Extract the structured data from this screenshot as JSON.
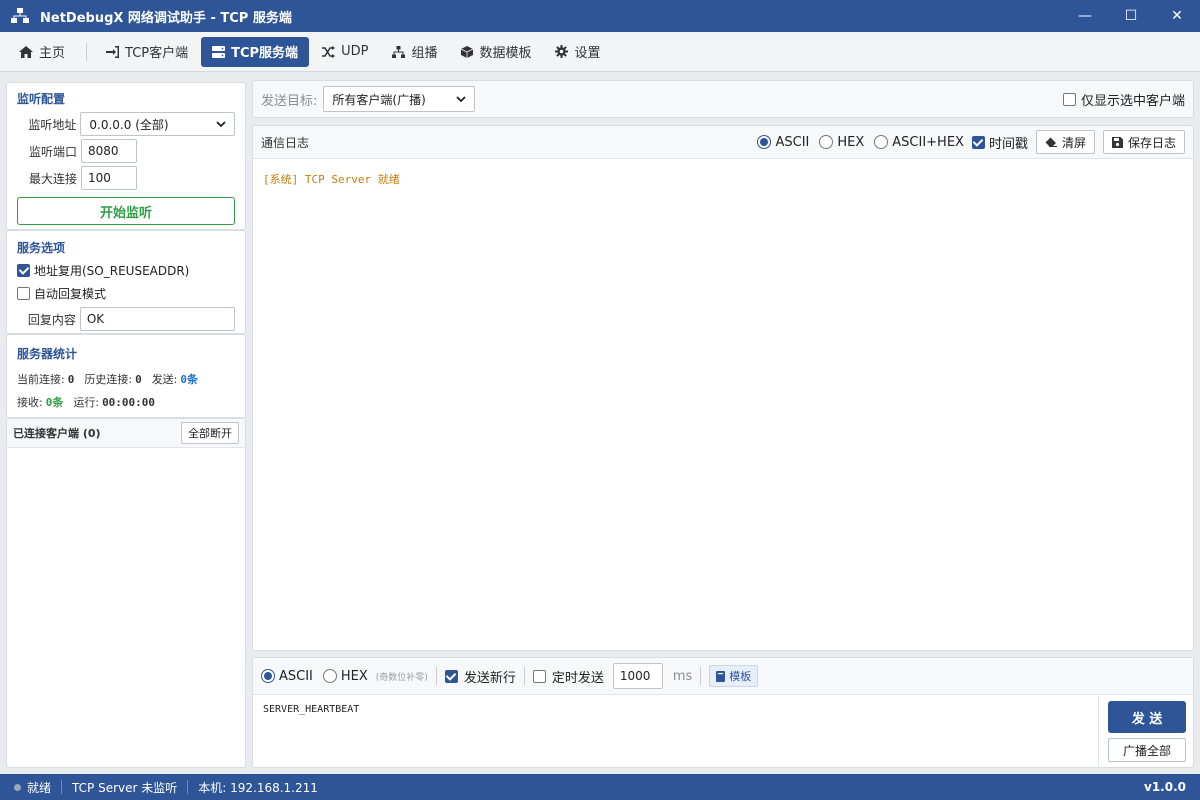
{
  "window": {
    "title": "NetDebugX 网络调试助手 - TCP 服务端",
    "minimize": "—",
    "maximize": "☐",
    "close": "✕"
  },
  "tabs": [
    {
      "label": "主页",
      "icon": "home-icon"
    },
    {
      "label": "TCP客户端",
      "icon": "sign-in-icon"
    },
    {
      "label": "TCP服务端",
      "icon": "server-icon",
      "active": true
    },
    {
      "label": "UDP",
      "icon": "shuffle-icon"
    },
    {
      "label": "组播",
      "icon": "sitemap-icon"
    },
    {
      "label": "数据模板",
      "icon": "cube-icon"
    },
    {
      "label": "设置",
      "icon": "gear-icon"
    }
  ],
  "listen": {
    "title": "监听配置",
    "addr_label": "监听地址",
    "addr_value": "0.0.0.0 (全部)",
    "port_label": "监听端口",
    "port_value": "8080",
    "max_label": "最大连接",
    "max_value": "100",
    "start_button": "开始监听"
  },
  "service": {
    "title": "服务选项",
    "reuse_label": "地址复用(SO_REUSEADDR)",
    "reuse_checked": true,
    "auto_reply_label": "自动回复模式",
    "auto_reply_checked": false,
    "reply_label": "回复内容",
    "reply_value": "OK"
  },
  "stats": {
    "title": "服务器统计",
    "current_label": "当前连接:",
    "current_value": "0",
    "history_label": "历史连接:",
    "history_value": "0",
    "sent_label": "发送:",
    "sent_value": "0条",
    "recv_label": "接收:",
    "recv_value": "0条",
    "uptime_label": "运行:",
    "uptime_value": "00:00:00"
  },
  "clients": {
    "title": "已连接客户端 (0)",
    "disconnect_all": "全部断开"
  },
  "send_target": {
    "label": "发送目标:",
    "value": "所有客户端(广播)",
    "only_selected_label": "仅显示选中客户端",
    "only_selected_checked": false
  },
  "log": {
    "title": "通信日志",
    "mode_ascii": "ASCII",
    "mode_hex": "HEX",
    "mode_both": "ASCII+HEX",
    "timestamp_label": "时间戳",
    "clear_button": "清屏",
    "save_button": "保存日志",
    "lines": [
      "[系统] TCP Server 就绪"
    ]
  },
  "send": {
    "mode_ascii": "ASCII",
    "mode_hex": "HEX",
    "hex_hint": "(奇数位补零)",
    "newline_label": "发送新行",
    "timer_label": "定时发送",
    "interval_value": "1000",
    "interval_unit": "ms",
    "template_button": "模板",
    "content": "SERVER_HEARTBEAT",
    "send_button": "发 送",
    "broadcast_button": "广播全部"
  },
  "statusbar": {
    "state": "就绪",
    "server_state": "TCP Server 未监听",
    "local_ip": "本机: 192.168.1.211",
    "version": "v1.0.0"
  },
  "colors": {
    "accent": "#2d5597",
    "green": "#2f9e44",
    "blue_value": "#1f6fd1",
    "log_text": "#c77b0c"
  }
}
